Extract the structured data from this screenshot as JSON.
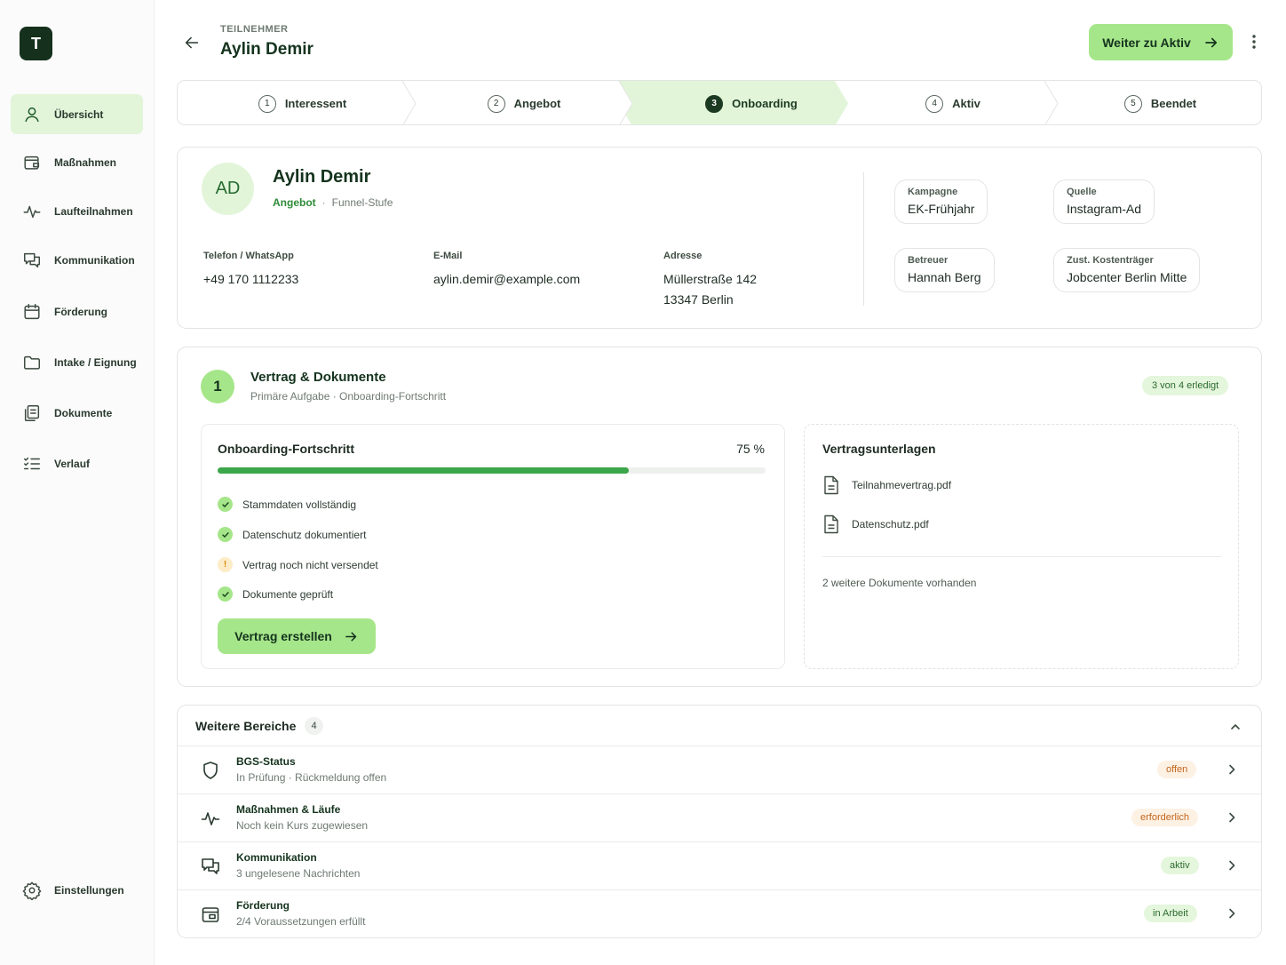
{
  "app": {
    "logo_letter": "T",
    "accent": "#a6e68a",
    "accent_dark": "#14331d"
  },
  "sidebar": {
    "items": [
      {
        "label": "Übersicht",
        "icon": "user-icon",
        "active": true
      },
      {
        "label": "Maßnahmen",
        "icon": "wallet-icon"
      },
      {
        "label": "Laufteilnahmen",
        "icon": "activity-icon"
      },
      {
        "label": "Kommunikation",
        "icon": "chat-icon"
      },
      {
        "label": "Förderung",
        "icon": "calendar-icon"
      },
      {
        "label": "Intake / Eignung",
        "icon": "folder-icon"
      },
      {
        "label": "Dokumente",
        "icon": "documents-icon"
      },
      {
        "label": "Verlauf",
        "icon": "checklist-icon"
      }
    ],
    "settings": {
      "label": "Einstellungen",
      "icon": "gear-icon"
    }
  },
  "header": {
    "breadcrumb": "TEILNEHMER",
    "title": "Aylin Demir",
    "primary_action": "Weiter zu Aktiv"
  },
  "stepper": {
    "steps": [
      {
        "num": "1",
        "label": "Interessent"
      },
      {
        "num": "2",
        "label": "Angebot"
      },
      {
        "num": "3",
        "label": "Onboarding",
        "active": true
      },
      {
        "num": "4",
        "label": "Aktiv"
      },
      {
        "num": "5",
        "label": "Beendet"
      }
    ]
  },
  "profile": {
    "initials": "AD",
    "name": "Aylin Demir",
    "stage": "Angebot",
    "stage_sep": "·",
    "stage_label": "Funnel-Stufe",
    "phone_label": "Telefon / WhatsApp",
    "phone": "+49 170 1112233",
    "email_label": "E-Mail",
    "email": "aylin.demir@example.com",
    "address_label": "Adresse",
    "address_line1": "Müllerstraße 142",
    "address_line2": "13347 Berlin",
    "chips": [
      {
        "label": "Kampagne",
        "value": "EK-Frühjahr"
      },
      {
        "label": "Quelle",
        "value": "Instagram-Ad"
      },
      {
        "label": "Betreuer",
        "value": "Hannah Berg"
      },
      {
        "label": "Zust. Kostenträger",
        "value": "Jobcenter Berlin Mitte"
      }
    ]
  },
  "task": {
    "num": "1",
    "title": "Vertrag & Dokumente",
    "subtitle": "Primäre Aufgabe · Onboarding-Fortschritt",
    "badge": "3 von 4 erledigt",
    "progress": {
      "title": "Onboarding-Fortschritt",
      "percent_label": "75 %",
      "value": 0.75
    },
    "checks": [
      {
        "label": "Stammdaten vollständig",
        "status": "done"
      },
      {
        "label": "Datenschutz dokumentiert",
        "status": "done"
      },
      {
        "label": "Vertrag noch nicht versendet",
        "status": "warning"
      },
      {
        "label": "Dokumente geprüft",
        "status": "done"
      }
    ],
    "action": "Vertrag erstellen",
    "documents": {
      "title": "Vertragsunterlagen",
      "files": [
        "Teilnahmevertrag.pdf",
        "Datenschutz.pdf"
      ],
      "more": "2 weitere Dokumente vorhanden"
    }
  },
  "areas": {
    "title": "Weitere Bereiche",
    "count": "4",
    "rows": [
      {
        "title": "BGS-Status",
        "subtitle": "In Prüfung · Rückmeldung offen",
        "badge": "offen",
        "badge_bg": "#fdf1e4",
        "badge_fg": "#c2651a",
        "icon": "shield-icon"
      },
      {
        "title": "Maßnahmen & Läufe",
        "subtitle": "Noch kein Kurs zugewiesen",
        "badge": "erforderlich",
        "badge_bg": "#fdf1e4",
        "badge_fg": "#c2651a",
        "icon": "activity-icon"
      },
      {
        "title": "Kommunikation",
        "subtitle": "3 ungelesene Nachrichten",
        "badge": "aktiv",
        "badge_bg": "#e4f6dc",
        "badge_fg": "#2c6b30",
        "icon": "chat-icon"
      },
      {
        "title": "Förderung",
        "subtitle": "2/4 Voraussetzungen erfüllt",
        "badge": "in Arbeit",
        "badge_bg": "#e4f6dc",
        "badge_fg": "#2c6b30",
        "icon": "funding-icon"
      }
    ]
  }
}
